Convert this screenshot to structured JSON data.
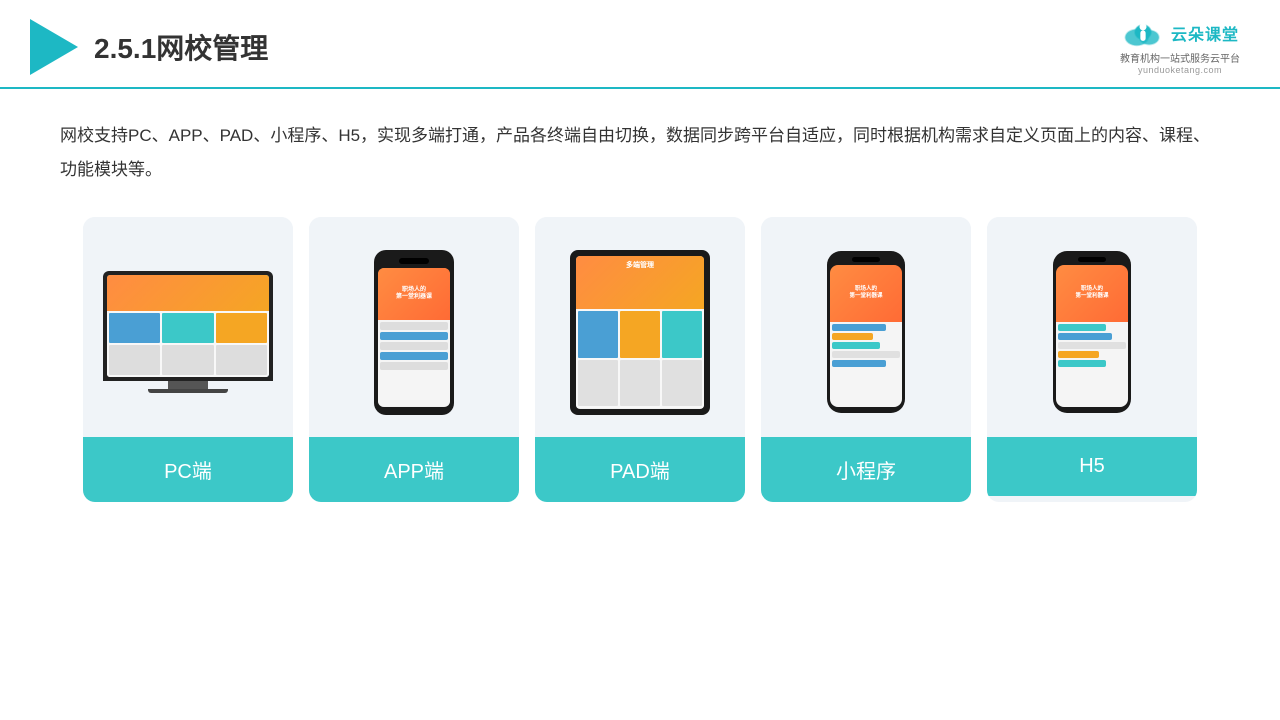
{
  "header": {
    "title": "2.5.1网校管理",
    "brand": {
      "name": "云朵课堂",
      "tagline": "教育机构一站\n式服务云平台",
      "url": "yunduoketang.com"
    }
  },
  "description": "网校支持PC、APP、PAD、小程序、H5，实现多端打通，产品各终端自由切换，数据同步跨平台自适应，同时根据机构需求自定义页面上的内容、课程、功能模块等。",
  "cards": [
    {
      "id": "pc",
      "label": "PC端"
    },
    {
      "id": "app",
      "label": "APP端"
    },
    {
      "id": "pad",
      "label": "PAD端"
    },
    {
      "id": "miniprogram",
      "label": "小程序"
    },
    {
      "id": "h5",
      "label": "H5"
    }
  ],
  "colors": {
    "teal": "#3cc8c8",
    "accent": "#1db8c4",
    "orange": "#ff8c42",
    "blue": "#4a9fd4"
  }
}
